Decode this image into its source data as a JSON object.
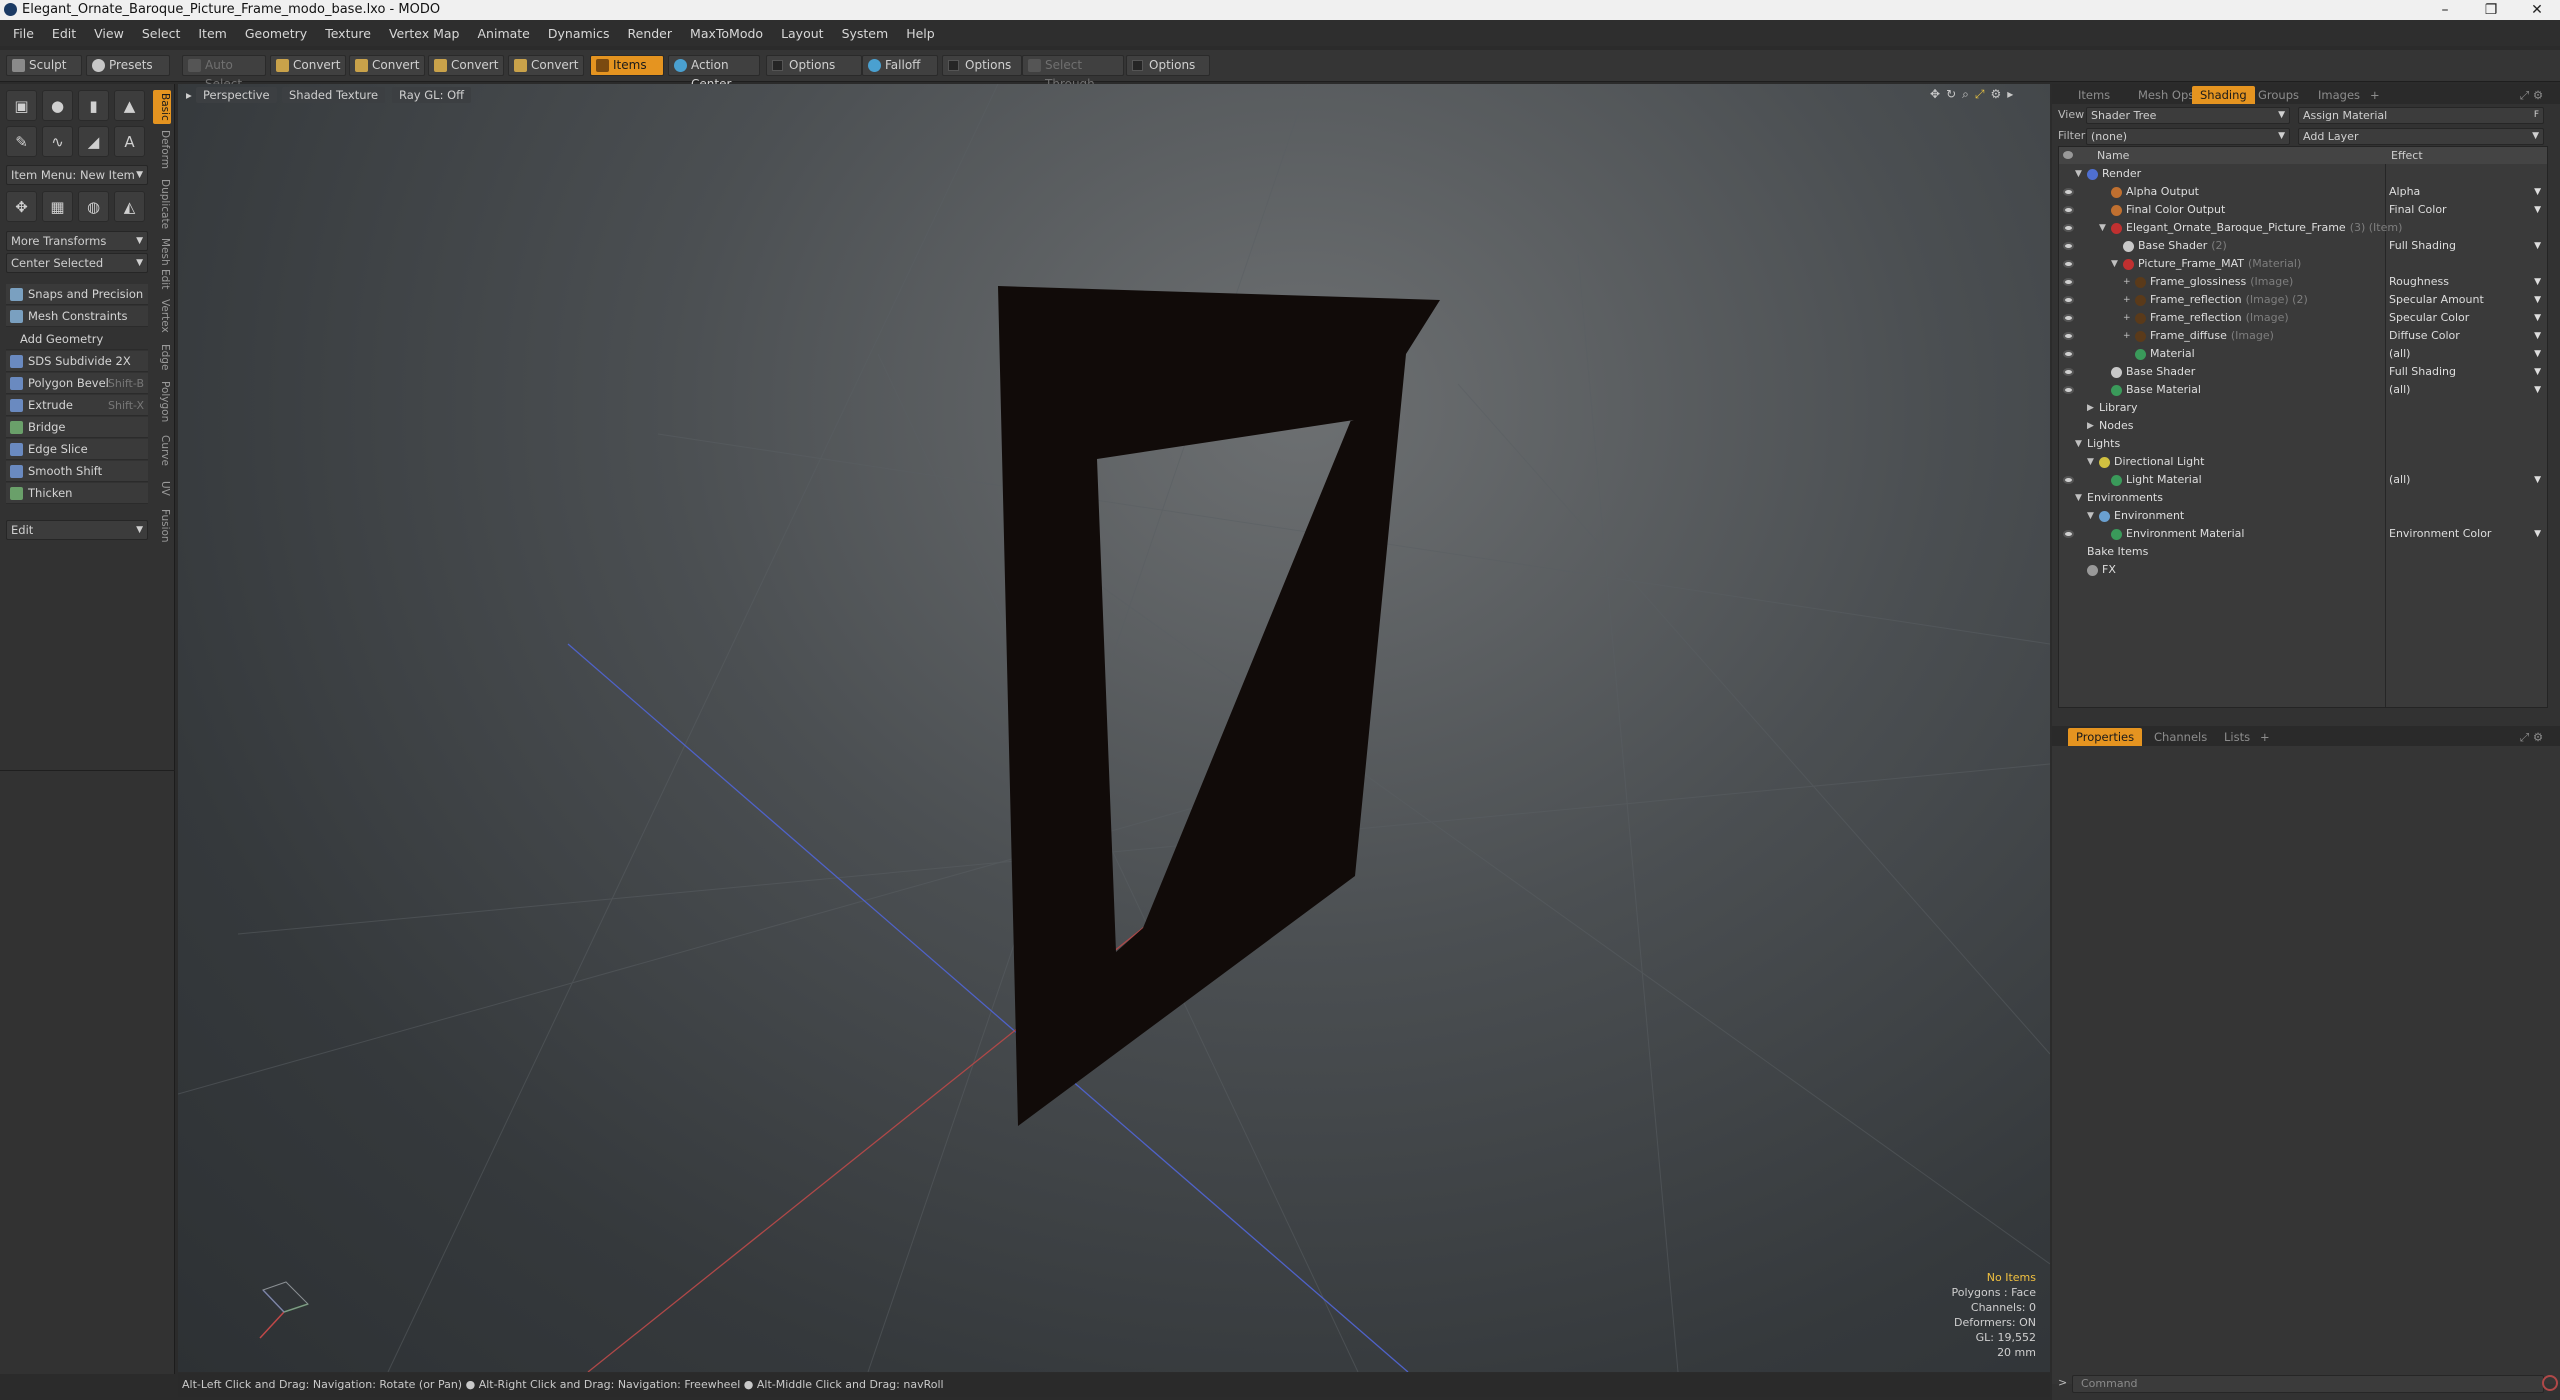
{
  "window": {
    "title": "Elegant_Ornate_Baroque_Picture_Frame_modo_base.lxo - MODO",
    "minimize": "–",
    "restore": "❐",
    "close": "✕"
  },
  "menu": [
    "File",
    "Edit",
    "View",
    "Select",
    "Item",
    "Geometry",
    "Texture",
    "Vertex Map",
    "Animate",
    "Dynamics",
    "Render",
    "MaxToModo",
    "Layout",
    "System",
    "Help"
  ],
  "toolbar": {
    "sculpt": "Sculpt",
    "presets": "Presets",
    "auto_select": "Auto Select",
    "convert1": "Convert",
    "convert2": "Convert",
    "convert3": "Convert",
    "convert4": "Convert",
    "items": "Items",
    "action_center": "Action Center",
    "options1": "Options",
    "falloff": "Falloff",
    "options2": "Options",
    "select_through": "Select Through",
    "options3": "Options"
  },
  "left_panel": {
    "item_menu": "Item Menu: New Item",
    "more_transforms": "More Transforms",
    "center_selected": "Center Selected",
    "snaps": "Snaps and Precision",
    "mesh_constraints": "Mesh Constraints",
    "add_geometry": "Add Geometry",
    "tools": [
      {
        "label": "SDS Subdivide 2X",
        "shortcut": ""
      },
      {
        "label": "Polygon Bevel",
        "shortcut": "Shift-B"
      },
      {
        "label": "Extrude",
        "shortcut": "Shift-X"
      },
      {
        "label": "Bridge",
        "shortcut": ""
      },
      {
        "label": "Edge Slice",
        "shortcut": ""
      },
      {
        "label": "Smooth Shift",
        "shortcut": ""
      },
      {
        "label": "Thicken",
        "shortcut": ""
      }
    ],
    "edit": "Edit",
    "vtabs": [
      "Basic",
      "Deform",
      "Duplicate",
      "Mesh Edit",
      "Vertex",
      "Edge",
      "Polygon",
      "Curve",
      "UV",
      "Fusion"
    ]
  },
  "viewport": {
    "perspective": "Perspective",
    "shaded_texture": "Shaded Texture",
    "ray_gl": "Ray GL: Off",
    "stats": {
      "no_items": "No Items",
      "polygons": "Polygons : Face",
      "channels": "Channels: 0",
      "deformers": "Deformers: ON",
      "gl": "GL: 19,552",
      "size": "20 mm"
    }
  },
  "statusbar": "Alt-Left Click and Drag: Navigation: Rotate (or Pan) ● Alt-Right Click and Drag: Navigation: Freewheel ● Alt-Middle Click and Drag: navRoll",
  "right_panel": {
    "tabs": [
      "Items",
      "Mesh Ops",
      "Shading",
      "Groups",
      "Images"
    ],
    "view_label": "View",
    "view_value": "Shader Tree",
    "assign_material": "Assign Material",
    "filter_label": "Filter",
    "filter_value": "(none)",
    "add_layer": "Add Layer",
    "col_name": "Name",
    "col_effect": "Effect",
    "tree": [
      {
        "name": "Render",
        "suffix": "",
        "effect": "",
        "eye": false,
        "indent": 0,
        "color": "#4f6fd0",
        "tw": "▼"
      },
      {
        "name": "Alpha Output",
        "suffix": "",
        "effect": "Alpha",
        "eye": true,
        "indent": 2,
        "color": "#c07030",
        "tw": ""
      },
      {
        "name": "Final Color Output",
        "suffix": "",
        "effect": "Final Color",
        "eye": true,
        "indent": 2,
        "color": "#c07030",
        "tw": ""
      },
      {
        "name": "Elegant_Ornate_Baroque_Picture_Frame",
        "suffix": "(3) (Item)",
        "effect": "",
        "eye": true,
        "indent": 2,
        "color": "#c03030",
        "tw": "▼"
      },
      {
        "name": "Base Shader",
        "suffix": "(2)",
        "effect": "Full Shading",
        "eye": true,
        "indent": 3,
        "color": "#c8c8c8",
        "tw": ""
      },
      {
        "name": "Picture_Frame_MAT",
        "suffix": "(Material)",
        "effect": "",
        "eye": true,
        "indent": 3,
        "color": "#c03030",
        "tw": "▼"
      },
      {
        "name": "Frame_glossiness",
        "suffix": "(Image)",
        "effect": "Roughness",
        "eye": true,
        "indent": 4,
        "color": "#5a3a1a",
        "tw": "+"
      },
      {
        "name": "Frame_reflection",
        "suffix": "(Image) (2)",
        "effect": "Specular Amount",
        "eye": true,
        "indent": 4,
        "color": "#5a3a1a",
        "tw": "+"
      },
      {
        "name": "Frame_reflection",
        "suffix": "(Image)",
        "effect": "Specular Color",
        "eye": true,
        "indent": 4,
        "color": "#5a3a1a",
        "tw": "+"
      },
      {
        "name": "Frame_diffuse",
        "suffix": "(Image)",
        "effect": "Diffuse Color",
        "eye": true,
        "indent": 4,
        "color": "#5a3a1a",
        "tw": "+"
      },
      {
        "name": "Material",
        "suffix": "",
        "effect": "(all)",
        "eye": true,
        "indent": 4,
        "color": "#3a9a5a",
        "tw": ""
      },
      {
        "name": "Base Shader",
        "suffix": "",
        "effect": "Full Shading",
        "eye": true,
        "indent": 2,
        "color": "#c8c8c8",
        "tw": ""
      },
      {
        "name": "Base Material",
        "suffix": "",
        "effect": "(all)",
        "eye": true,
        "indent": 2,
        "color": "#3a9a5a",
        "tw": ""
      },
      {
        "name": "Library",
        "suffix": "",
        "effect": "",
        "eye": false,
        "indent": 1,
        "color": "",
        "tw": "▶"
      },
      {
        "name": "Nodes",
        "suffix": "",
        "effect": "",
        "eye": false,
        "indent": 1,
        "color": "",
        "tw": "▶"
      },
      {
        "name": "Lights",
        "suffix": "",
        "effect": "",
        "eye": false,
        "indent": 0,
        "color": "",
        "tw": "▼"
      },
      {
        "name": "Directional Light",
        "suffix": "",
        "effect": "",
        "eye": false,
        "indent": 1,
        "color": "#d0c040",
        "tw": "▼"
      },
      {
        "name": "Light Material",
        "suffix": "",
        "effect": "(all)",
        "eye": true,
        "indent": 2,
        "color": "#3a9a5a",
        "tw": ""
      },
      {
        "name": "Environments",
        "suffix": "",
        "effect": "",
        "eye": false,
        "indent": 0,
        "color": "",
        "tw": "▼"
      },
      {
        "name": "Environment",
        "suffix": "",
        "effect": "",
        "eye": false,
        "indent": 1,
        "color": "#6aa0d0",
        "tw": "▼"
      },
      {
        "name": "Environment Material",
        "suffix": "",
        "effect": "Environment Color",
        "eye": true,
        "indent": 2,
        "color": "#3a9a5a",
        "tw": ""
      },
      {
        "name": "Bake Items",
        "suffix": "",
        "effect": "",
        "eye": false,
        "indent": 0,
        "color": "",
        "tw": ""
      },
      {
        "name": "FX",
        "suffix": "",
        "effect": "",
        "eye": false,
        "indent": 0,
        "color": "#999999",
        "tw": ""
      }
    ],
    "bottom_tabs": [
      "Properties",
      "Channels",
      "Lists"
    ],
    "command_placeholder": "Command"
  },
  "colors": {
    "accent": "#e59420",
    "frame": "#110b09"
  }
}
